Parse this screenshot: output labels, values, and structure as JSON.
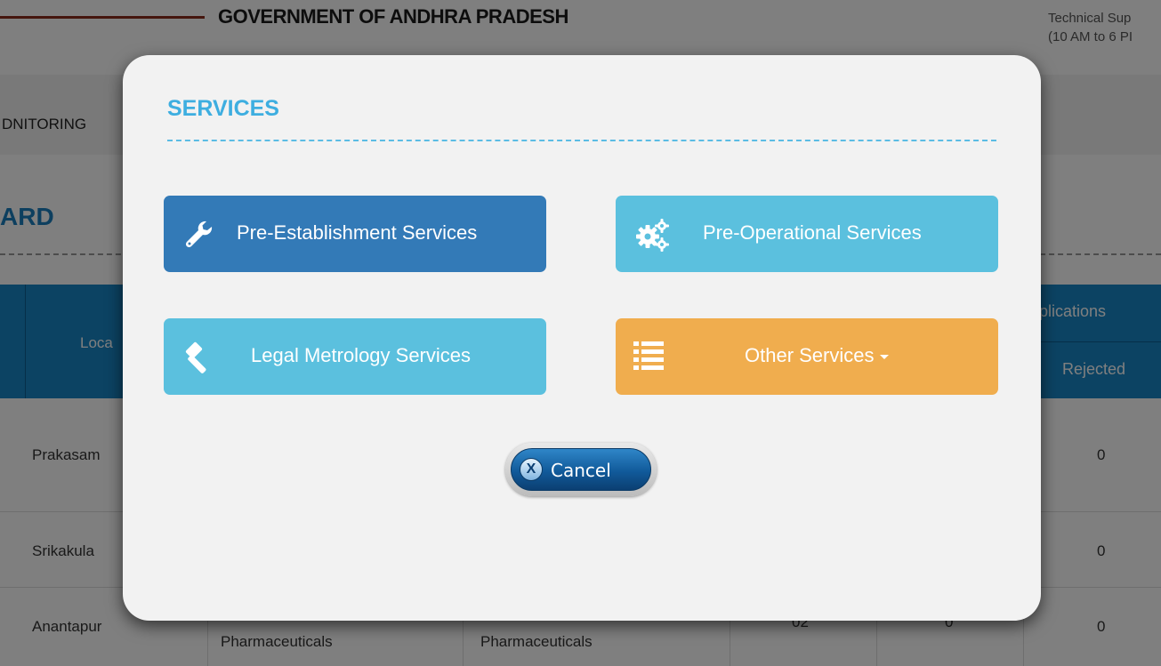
{
  "background": {
    "gov_title": "GOVERNMENT OF ANDHRA PRADESH",
    "support_line1": "Technical Sup",
    "support_line2": "(10 AM to 6 PI",
    "nav_item": "DNITORING",
    "dashboard_title": "ARD",
    "table": {
      "header_location": "Loca",
      "header_applications": "plications",
      "header_rejected": "Rejected",
      "rows": [
        {
          "location": "Prakasam",
          "rejected": "0"
        },
        {
          "location": "Srikakula",
          "rejected": "0"
        },
        {
          "location": "Anantapur",
          "col2": "Pharmaceuticals",
          "col3": "Pharmaceuticals",
          "col4": "02",
          "col5": "0",
          "rejected": "0"
        }
      ]
    }
  },
  "modal": {
    "title": "SERVICES",
    "buttons": {
      "pre_establishment": "Pre-Establishment Services",
      "pre_operational": "Pre-Operational Services",
      "legal_metrology": "Legal Metrology Services",
      "other_services": "Other Services"
    },
    "icons": {
      "pre_establishment": "wrench-icon",
      "pre_operational": "gears-icon",
      "legal_metrology": "gavel-icon",
      "other_services": "list-icon",
      "cancel": "close-circle-icon"
    },
    "cancel_label": "Cancel",
    "cancel_icon_glyph": "X"
  },
  "colors": {
    "primary": "#337ab7",
    "info": "#5bc0de",
    "warning": "#f0ad4e",
    "title": "#3eaee0"
  }
}
